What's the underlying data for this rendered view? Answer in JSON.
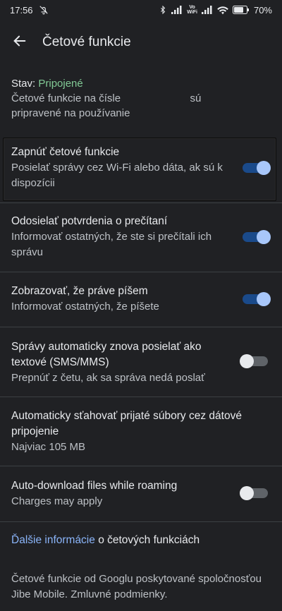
{
  "status_bar": {
    "time": "17:56",
    "battery_percent": "70%",
    "vowifi_top": "Vo",
    "vowifi_bottom": "WiFi",
    "icons": [
      "bell-off-icon",
      "bluetooth-icon",
      "signal-icon",
      "wifi-icon",
      "battery-icon"
    ]
  },
  "app_bar": {
    "title": "Četové funkcie"
  },
  "status": {
    "label": "Stav: ",
    "value": "Pripojené",
    "desc_part1": "Četové funkcie na čísle",
    "desc_part2": "sú",
    "desc_part3": "pripravené na používanie"
  },
  "settings": [
    {
      "title": "Zapnúť četové funkcie",
      "subtitle": "Posielať správy cez Wi-Fi alebo dáta, ak sú k dispozícii",
      "toggle": true
    },
    {
      "title": "Odosielať potvrdenia o prečítaní",
      "subtitle": "Informovať ostatných, že ste si prečítali ich správu",
      "toggle": true
    },
    {
      "title": "Zobrazovať, že práve píšem",
      "subtitle": "Informovať ostatných, že píšete",
      "toggle": true
    },
    {
      "title": "Správy automaticky znova posielať ako textové (SMS/MMS)",
      "subtitle": "Prepnúť z četu, ak sa správa nedá poslať",
      "toggle": false
    },
    {
      "title": "Automaticky sťahovať prijaté súbory cez dátové pripojenie",
      "subtitle": "Najviac 105 MB",
      "toggle": null
    },
    {
      "title": "Auto-download files while roaming",
      "subtitle": "Charges may apply",
      "toggle": false
    }
  ],
  "more_info": {
    "link": "Ďalšie informácie",
    "rest": " o četových funkciách"
  },
  "footer": {
    "text": "Četové funkcie od Googlu poskytované spoločnosťou Jibe Mobile. Zmluvné podmienky."
  },
  "colors": {
    "background": "#202124",
    "accent_green": "#81c995",
    "link_blue": "#8ab4f8",
    "switch_on_track": "#1a4a8a",
    "switch_on_knob": "#a8c7fa"
  }
}
